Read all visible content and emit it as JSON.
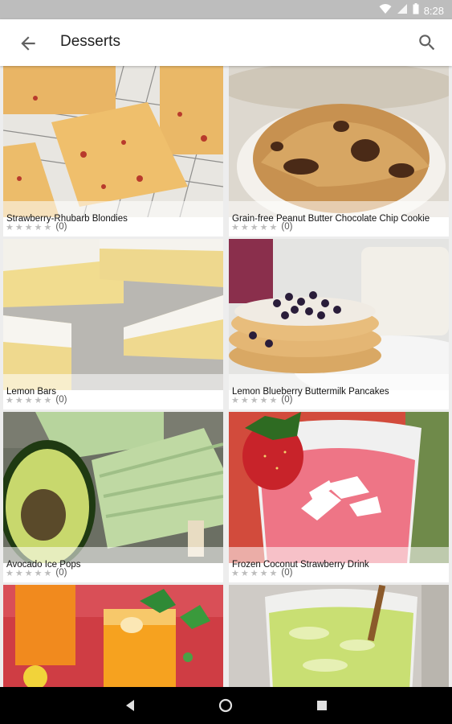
{
  "status_bar": {
    "time": "8:28",
    "icons": [
      "wifi-icon",
      "signal-icon",
      "battery-icon"
    ]
  },
  "app_bar": {
    "title": "Desserts",
    "back_icon": "arrow-back-icon",
    "search_icon": "search-icon"
  },
  "recipes": [
    {
      "title": "Strawberry-Rhubarb Blondies",
      "rating": 0,
      "rating_count": "(0)"
    },
    {
      "title": "Grain-free Peanut Butter Chocolate Chip Cookie",
      "rating": 0,
      "rating_count": "(0)"
    },
    {
      "title": "Lemon Bars",
      "rating": 0,
      "rating_count": "(0)"
    },
    {
      "title": "Lemon Blueberry Buttermilk Pancakes",
      "rating": 0,
      "rating_count": "(0)"
    },
    {
      "title": "Avocado Ice Pops",
      "rating": 0,
      "rating_count": "(0)"
    },
    {
      "title": "Frozen Coconut Strawberry Drink",
      "rating": 0,
      "rating_count": "(0)"
    },
    {
      "title": "",
      "rating": 0,
      "rating_count": ""
    },
    {
      "title": "",
      "rating": 0,
      "rating_count": ""
    }
  ],
  "nav_bar": {
    "icons": [
      "nav-back-icon",
      "nav-home-icon",
      "nav-recents-icon"
    ]
  },
  "colors": {
    "app_bar_bg": "#ffffff",
    "status_bar_bg": "#bdbdbd",
    "star_empty": "#bdbdbd",
    "nav_bar_bg": "#000000"
  }
}
